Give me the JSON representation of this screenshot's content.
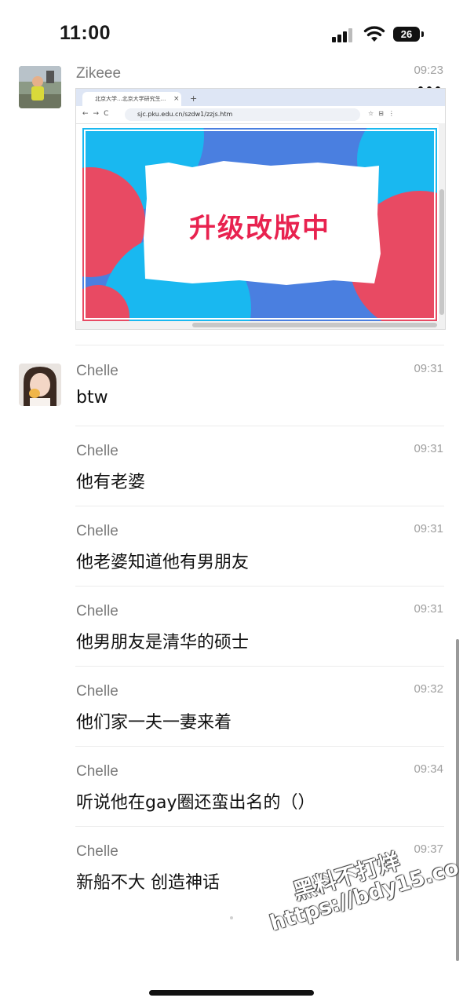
{
  "status_bar": {
    "time": "11:00",
    "battery": "26"
  },
  "header": {
    "back_icon": "chevron-left-icon",
    "more_icon": "ellipsis-icon"
  },
  "colors": {
    "accent_red": "#e83a5f",
    "accent_blue": "#4a7fe0",
    "accent_cyan": "#19b8f0"
  },
  "messages": [
    {
      "sender": "Zikeee",
      "time": "09:23",
      "type": "image"
    },
    {
      "sender": "Chelle",
      "time": "09:31",
      "text": "btw"
    },
    {
      "sender": "Chelle",
      "time": "09:31",
      "text": "他有老婆"
    },
    {
      "sender": "Chelle",
      "time": "09:31",
      "text": "他老婆知道他有男朋友"
    },
    {
      "sender": "Chelle",
      "time": "09:31",
      "text": "他男朋友是清华的硕士"
    },
    {
      "sender": "Chelle",
      "time": "09:32",
      "text": "他们家一夫一妻来着"
    },
    {
      "sender": "Chelle",
      "time": "09:34",
      "text": "听说他在gay圈还蛮出名的（）"
    },
    {
      "sender": "Chelle",
      "time": "09:37",
      "text": "新船不大 创造神话"
    }
  ],
  "screenshot": {
    "tab_title": "北京大学...北京大学研究生...",
    "url": "sjc.pku.edu.cn/szdw1/zzjs.htm",
    "banner_text": "升级改版中"
  },
  "watermark": {
    "line1": "黑料不打烊",
    "line2": "https://bdy15.co"
  }
}
